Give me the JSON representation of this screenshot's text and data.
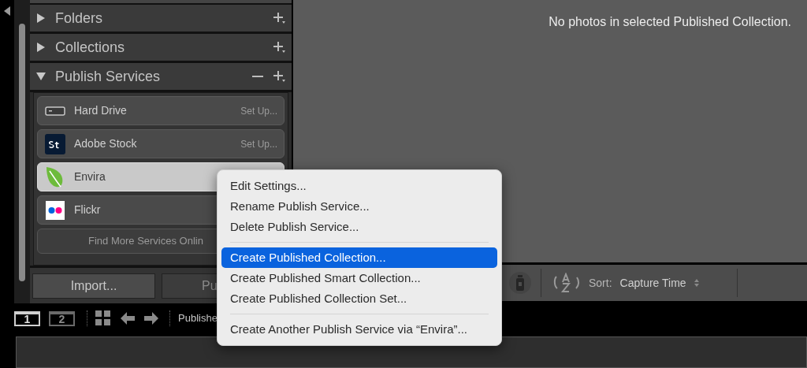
{
  "main": {
    "message": "No photos in selected Published Collection."
  },
  "panels": [
    {
      "label": "Folders",
      "expanded": false
    },
    {
      "label": "Collections",
      "expanded": false
    },
    {
      "label": "Publish Services",
      "expanded": true
    }
  ],
  "services": [
    {
      "kind": "drive",
      "name": "Hard Drive",
      "action": "Set Up...",
      "selected": false
    },
    {
      "kind": "stock",
      "name": "Adobe Stock",
      "action": "Set Up...",
      "selected": false
    },
    {
      "kind": "leaf",
      "name": "Envira",
      "selected": true
    },
    {
      "kind": "dots",
      "name": "Flickr",
      "selected": false
    }
  ],
  "find_more": "Find More Services Onlin",
  "buttons": [
    "Import...",
    "Pu"
  ],
  "toolbar": {
    "sort_label": "Sort:",
    "sort_value": "Capture Time"
  },
  "filmstrip": {
    "screens": [
      {
        "label": "1",
        "selected": true
      },
      {
        "label": "2",
        "selected": false
      }
    ],
    "source": "Publishe"
  },
  "context_menu": {
    "groups": [
      [
        {
          "label": "Edit Settings...",
          "selected": false
        },
        {
          "label": "Rename Publish Service...",
          "selected": false
        },
        {
          "label": "Delete Publish Service...",
          "selected": false
        }
      ],
      [
        {
          "label": "Create Published Collection...",
          "selected": true
        },
        {
          "label": "Create Published Smart Collection...",
          "selected": false
        },
        {
          "label": "Create Published Collection Set...",
          "selected": false
        }
      ],
      [
        {
          "label": "Create Another Publish Service via “Envira”...",
          "selected": false
        }
      ]
    ]
  }
}
